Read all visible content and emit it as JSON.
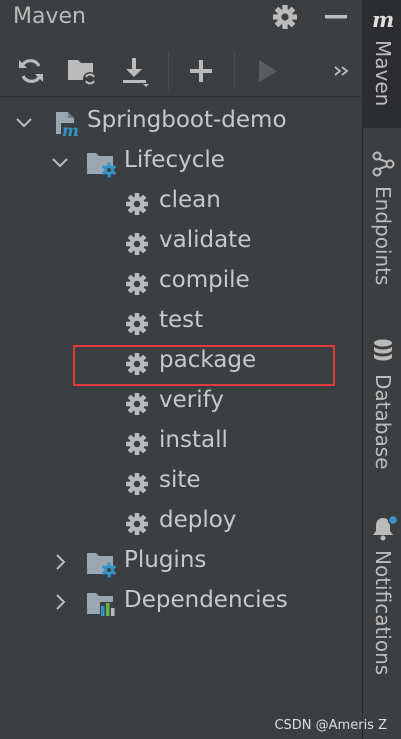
{
  "header": {
    "title": "Maven",
    "settings_icon": "gear-icon",
    "minimize_icon": "minimize-icon"
  },
  "toolbar": {
    "buttons": [
      "reload-icon",
      "reimport-folder-icon",
      "download-icon",
      "add-icon",
      "run-icon",
      "more-icon"
    ]
  },
  "tree": {
    "project": "Springboot-demo",
    "lifecycle": {
      "label": "Lifecycle",
      "goals": [
        "clean",
        "validate",
        "compile",
        "test",
        "package",
        "verify",
        "install",
        "site",
        "deploy"
      ]
    },
    "plugins": "Plugins",
    "dependencies": "Dependencies"
  },
  "sidebar": {
    "tabs": [
      {
        "label": "Maven",
        "icon": "maven-m-icon",
        "active": true
      },
      {
        "label": "Endpoints",
        "icon": "endpoints-icon",
        "active": false
      },
      {
        "label": "Database",
        "icon": "database-icon",
        "active": false
      },
      {
        "label": "Notifications",
        "icon": "bell-icon",
        "active": false
      }
    ]
  },
  "watermark": "CSDN @Ameris Z",
  "colors": {
    "highlight": "#e0393e",
    "accent_blue": "#3592c4",
    "background": "#3c3f41"
  }
}
